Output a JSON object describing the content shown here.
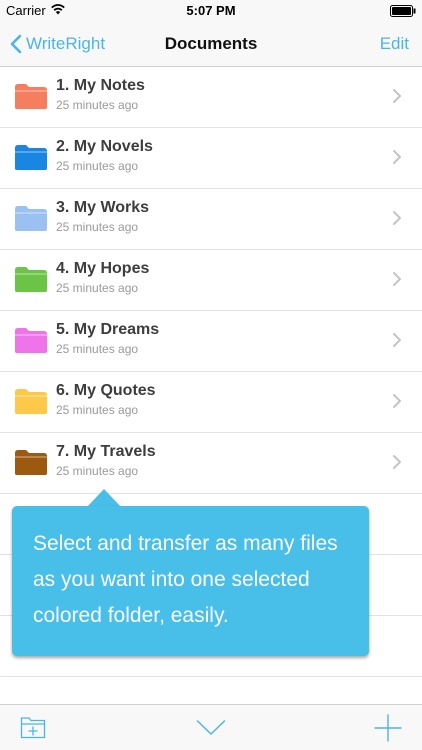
{
  "status_bar": {
    "carrier": "Carrier",
    "time": "5:07 PM"
  },
  "nav": {
    "back_label": "WriteRight",
    "title": "Documents",
    "edit_label": "Edit"
  },
  "colors": {
    "accent": "#4cb5e6",
    "tooltip": "#47bfe8"
  },
  "folders": [
    {
      "title": "1. My Notes",
      "subtitle": "25 minutes ago",
      "color": "#f47e5e"
    },
    {
      "title": "2. My Novels",
      "subtitle": "25 minutes ago",
      "color": "#1a86e0"
    },
    {
      "title": "3. My Works",
      "subtitle": "25 minutes ago",
      "color": "#9bc1f2"
    },
    {
      "title": "4. My Hopes",
      "subtitle": "25 minutes ago",
      "color": "#6cc448"
    },
    {
      "title": "5. My Dreams",
      "subtitle": "25 minutes ago",
      "color": "#ee74ea"
    },
    {
      "title": "6. My Quotes",
      "subtitle": "25 minutes ago",
      "color": "#fbc94a"
    },
    {
      "title": "7. My Travels",
      "subtitle": "25 minutes ago",
      "color": "#9c5a12"
    }
  ],
  "tooltip": {
    "text": "Select and transfer as many files as you want into one selected colored folder, easily."
  },
  "toolbar": {
    "new_folder_icon": "new-folder-icon",
    "collapse_icon": "chevron-down-icon",
    "add_icon": "plus-icon"
  }
}
